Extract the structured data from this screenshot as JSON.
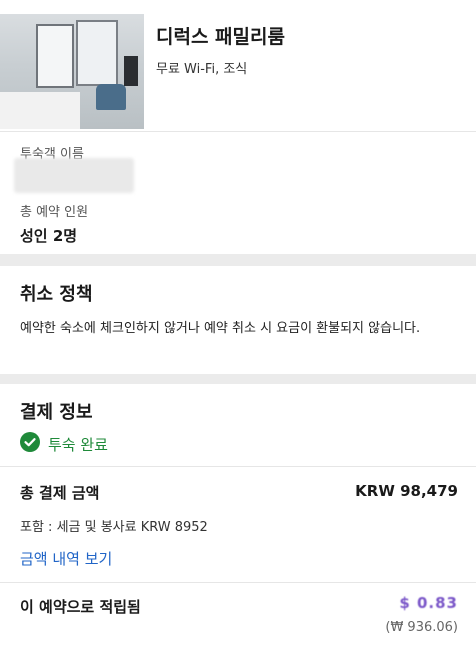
{
  "room": {
    "title": "디럭스 패밀리룸",
    "amenities": "무료 Wi-Fi, 조식",
    "guest_name_label": "투숙객 이름",
    "guest_count_label": "총 예약 인원",
    "guest_count_value": "성인 2명"
  },
  "cancellation": {
    "title": "취소 정책",
    "text": "예약한 숙소에 체크인하지 않거나 예약 취소 시 요금이 환불되지 않습니다."
  },
  "payment": {
    "title": "결제 정보",
    "status": "투숙 완료",
    "status_icon": "check-circle-icon",
    "total_label": "총 결제 금액",
    "total_value": "KRW 98,479",
    "tax_note": "포함 : 세금 및 봉사료 KRW 8952",
    "details_link": "금액 내역 보기",
    "earn_label": "이 예약으로 적립됨",
    "earn_value": "$ 0.83",
    "earn_krw": "(₩ 936.06)"
  },
  "colors": {
    "success": "#1f8a3a",
    "link": "#2165c7",
    "reward": "#7a56c8"
  }
}
